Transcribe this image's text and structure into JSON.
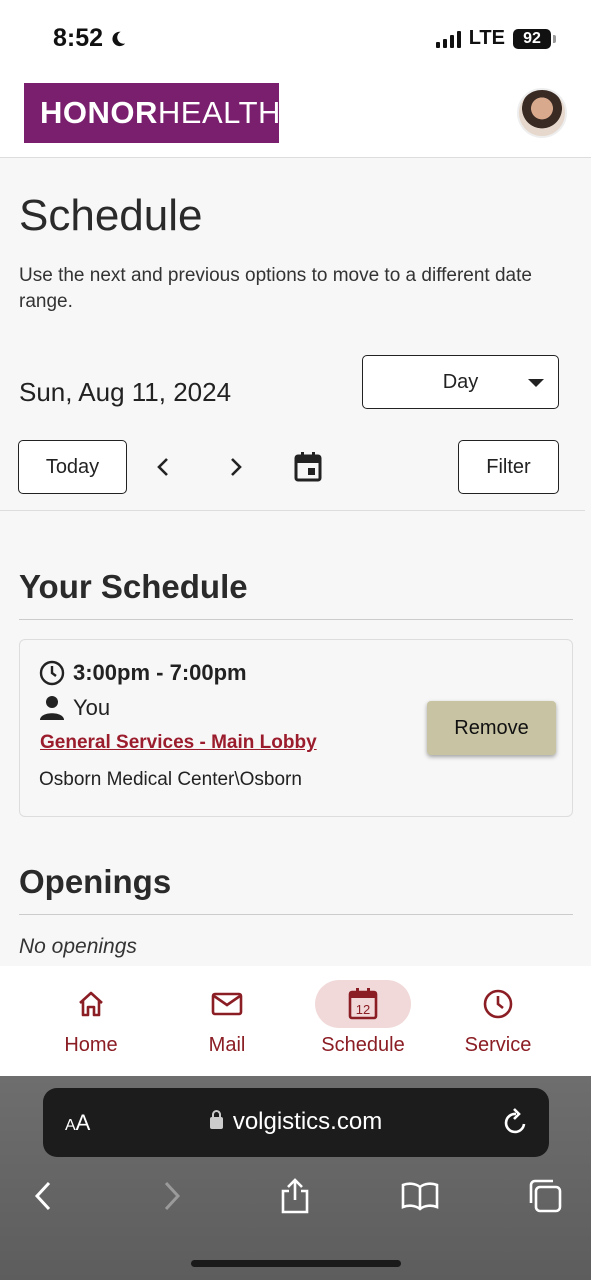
{
  "status": {
    "time": "8:52",
    "network": "LTE",
    "battery": "92"
  },
  "header": {
    "logo_bold": "HONOR",
    "logo_thin": "HEALTH",
    "logo_tm": "TM"
  },
  "page": {
    "title": "Schedule",
    "intro": "Use the next and previous options to move to a different date range.",
    "date": "Sun, Aug 11, 2024",
    "view_select": "Day",
    "today_label": "Today",
    "filter_label": "Filter"
  },
  "your_schedule": {
    "title": "Your Schedule",
    "shift": {
      "time": "3:00pm - 7:00pm",
      "person": "You",
      "assignment": "General Services - Main Lobby",
      "location": "Osborn Medical Center\\Osborn",
      "remove_label": "Remove"
    }
  },
  "openings": {
    "title": "Openings",
    "empty": "No openings"
  },
  "appnav": {
    "items": [
      {
        "label": "Home",
        "icon": "home-icon"
      },
      {
        "label": "Mail",
        "icon": "mail-icon"
      },
      {
        "label": "Schedule",
        "icon": "calendar-icon",
        "badge": "12",
        "active": true
      },
      {
        "label": "Service",
        "icon": "clock-icon"
      }
    ]
  },
  "browser": {
    "aa_large": "A",
    "aa_small": "A",
    "url": "volgistics.com"
  },
  "colors": {
    "brand": "#7a1f6e",
    "accent": "#8b1d24",
    "remove_button": "#c8c4a3"
  }
}
